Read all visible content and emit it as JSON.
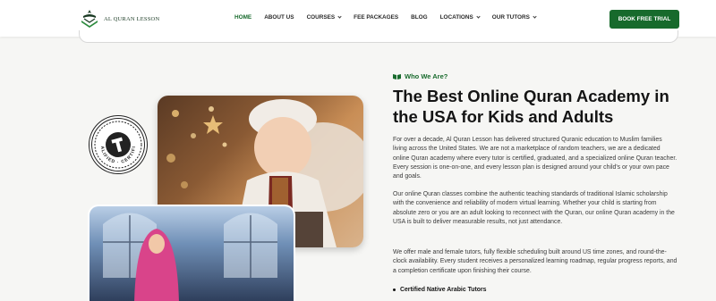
{
  "brand": {
    "name": "AL QURAN LESSON"
  },
  "nav": {
    "items": [
      {
        "label": "HOME",
        "active": true,
        "dropdown": false
      },
      {
        "label": "ABOUT US",
        "active": false,
        "dropdown": false
      },
      {
        "label": "COURSES",
        "active": false,
        "dropdown": true
      },
      {
        "label": "FEE PACKAGES",
        "active": false,
        "dropdown": false
      },
      {
        "label": "BLOG",
        "active": false,
        "dropdown": false
      },
      {
        "label": "LOCATIONS",
        "active": false,
        "dropdown": true
      },
      {
        "label": "OUR TUTORS",
        "active": false,
        "dropdown": true
      }
    ],
    "cta_label": "BOOK FREE TRIAL"
  },
  "badge": {
    "text": "QUALIFIED · CERTIFIED"
  },
  "section": {
    "eyebrow": "Who We Are?",
    "title": "The Best Online Quran Academy in the USA for Kids and Adults",
    "paragraphs": [
      "For over a decade, Al Quran Lesson has delivered structured Quranic education to Muslim families living across the United States. We are not a marketplace of random teachers, we are a dedicated online Quran academy where every tutor is certified, graduated, and a specialized online Quran teacher. Every session is one-on-one, and every lesson plan is designed around your child's or your own pace and goals.",
      "Our online Quran classes combine the authentic teaching standards of traditional Islamic scholarship with the convenience and reliability of modern virtual learning. Whether your child is starting from absolute zero or you are an adult looking to reconnect with the Quran, our online Quran academy in the USA is built to deliver measurable results, not just attendance.",
      "We offer male and female tutors, fully flexible scheduling built around US time zones, and round-the-clock availability. Every student receives a personalized learning roadmap, regular progress reports, and a completion certificate upon finishing their course."
    ],
    "bullets": [
      "Certified Native Arabic Tutors"
    ]
  },
  "colors": {
    "accent": "#176a2c",
    "text": "#141414",
    "background": "#f6f6f4"
  }
}
